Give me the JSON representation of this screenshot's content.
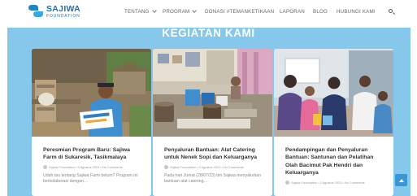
{
  "brand": {
    "name": "SAJIWA",
    "tagline": "FOUNDATION"
  },
  "nav": {
    "items": [
      {
        "label": "TENTANG",
        "has_dropdown": true
      },
      {
        "label": "PROGRAM",
        "has_dropdown": true
      },
      {
        "label": "DONASI #TEMANKETIKAAN",
        "has_dropdown": false
      },
      {
        "label": "LAPORAN",
        "has_dropdown": false
      },
      {
        "label": "BLOG",
        "has_dropdown": false
      },
      {
        "label": "HUBUNGI KAMI",
        "has_dropdown": false
      }
    ],
    "search_icon": "search-icon"
  },
  "section": {
    "title": "KEGIATAN KAMI"
  },
  "cards": [
    {
      "title": "Peresmian Program Baru: Sajiwa Farm di Sukaresik, Tasikmalaya",
      "meta": "Sajiwa Foundation • 9 Agustus 2023 • No Comments",
      "excerpt": "Udah tau tentang Sajiwa Farm belum? Program ini berkolaborasi dengan…"
    },
    {
      "title": "Penyaluran Bantuan: Alat Catering untuk Nenek Sopi dan Keluarganya",
      "meta": "Sajiwa Foundation • 3 Agustus 2023 • No Comments",
      "excerpt": "Pada hari Jumat (28/07/23) tim Sajiwa menyalurkan bantuan alat catering…"
    },
    {
      "title": "Pendampingan dan Penyaluran Bantuan: Santunan dan Pelatihan Olah Bacimut Pak Hendri dan Keluarganya",
      "meta": "Sajiwa Foundation • 2 Agustus 2023 • No Comments",
      "excerpt": ""
    }
  ],
  "colors": {
    "banner": "#86c7ec",
    "brand_blue": "#1d6fb1",
    "scroll_button": "#3a96d1"
  },
  "scroll_top_icon": "arrow-up-icon"
}
